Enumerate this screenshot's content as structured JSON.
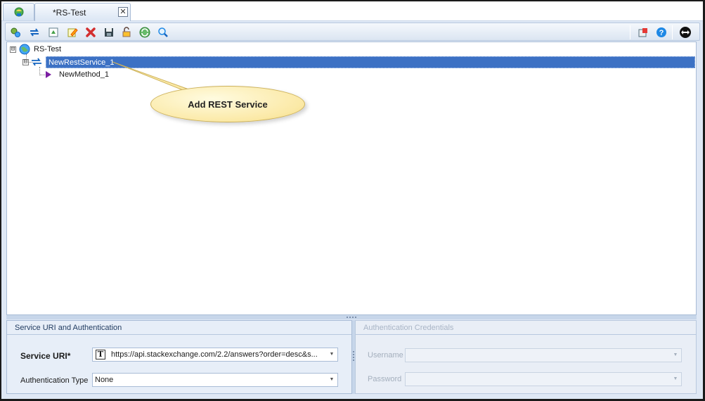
{
  "tab": {
    "title": "*RS-Test",
    "close": "✕"
  },
  "toolbar": {
    "left_icons": [
      "add-rest-service-icon",
      "add-method-icon",
      "refresh-schema-icon",
      "edit-icon",
      "delete-icon",
      "save-icon",
      "lock-icon",
      "sync-icon",
      "search-icon"
    ],
    "right_icons": [
      "export-icon",
      "help-icon",
      "navigate-icon"
    ]
  },
  "tree": {
    "root": {
      "label": "RS-Test",
      "expander": "⊟"
    },
    "service": {
      "label": "NewRestService_1",
      "expander": "⊟"
    },
    "method": {
      "label": "NewMethod_1"
    }
  },
  "callout": {
    "text": "Add REST Service"
  },
  "service_panel": {
    "title": "Service URI and Authentication",
    "uri_label": "Service URI*",
    "uri_value": "https://api.stackexchange.com/2.2/answers?order=desc&s...",
    "uri_type_glyph": "T",
    "auth_label": "Authentication Type",
    "auth_value": "None"
  },
  "credentials_panel": {
    "title": "Authentication Credentials",
    "username_label": "Username",
    "username_value": "",
    "password_label": "Password",
    "password_value": ""
  },
  "colors": {
    "selection": "#3c71c4",
    "panel_bg": "#dfe8f5",
    "callout": "#fbe9a6"
  }
}
